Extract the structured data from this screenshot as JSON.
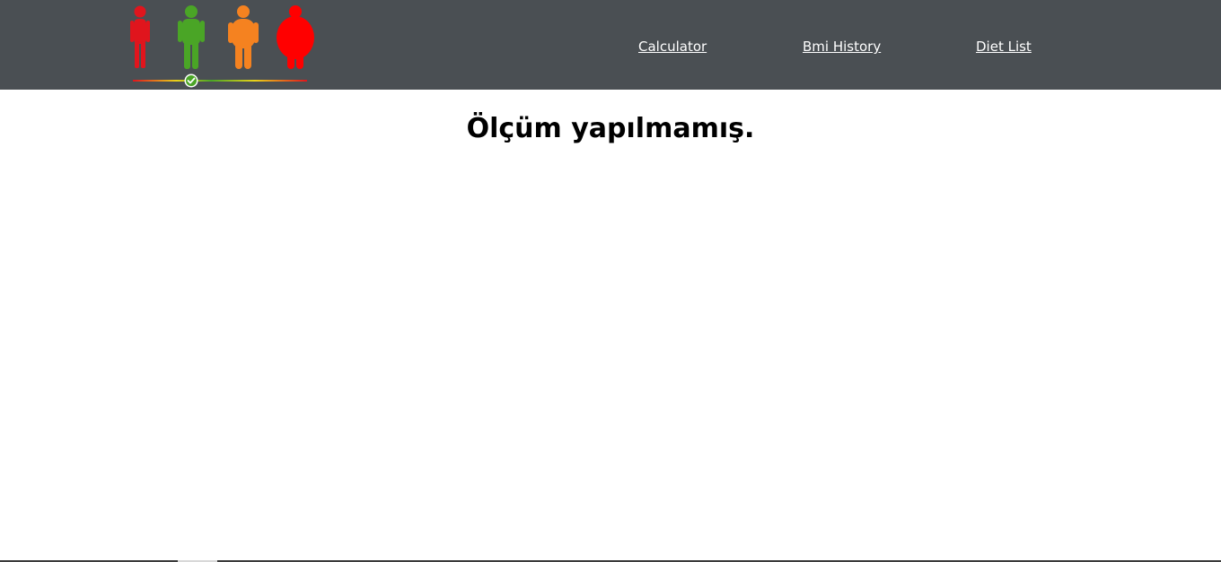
{
  "header": {
    "logo_icon": "bmi-body-types-logo-icon",
    "logo_colors": [
      "#e0151d",
      "#4aa526",
      "#f58220",
      "#ff0000"
    ],
    "nav": {
      "calculator": "Calculator",
      "bmi_history": "Bmi History",
      "diet_list": "Diet List"
    }
  },
  "main": {
    "message": "Ölçüm yapılmamış."
  }
}
